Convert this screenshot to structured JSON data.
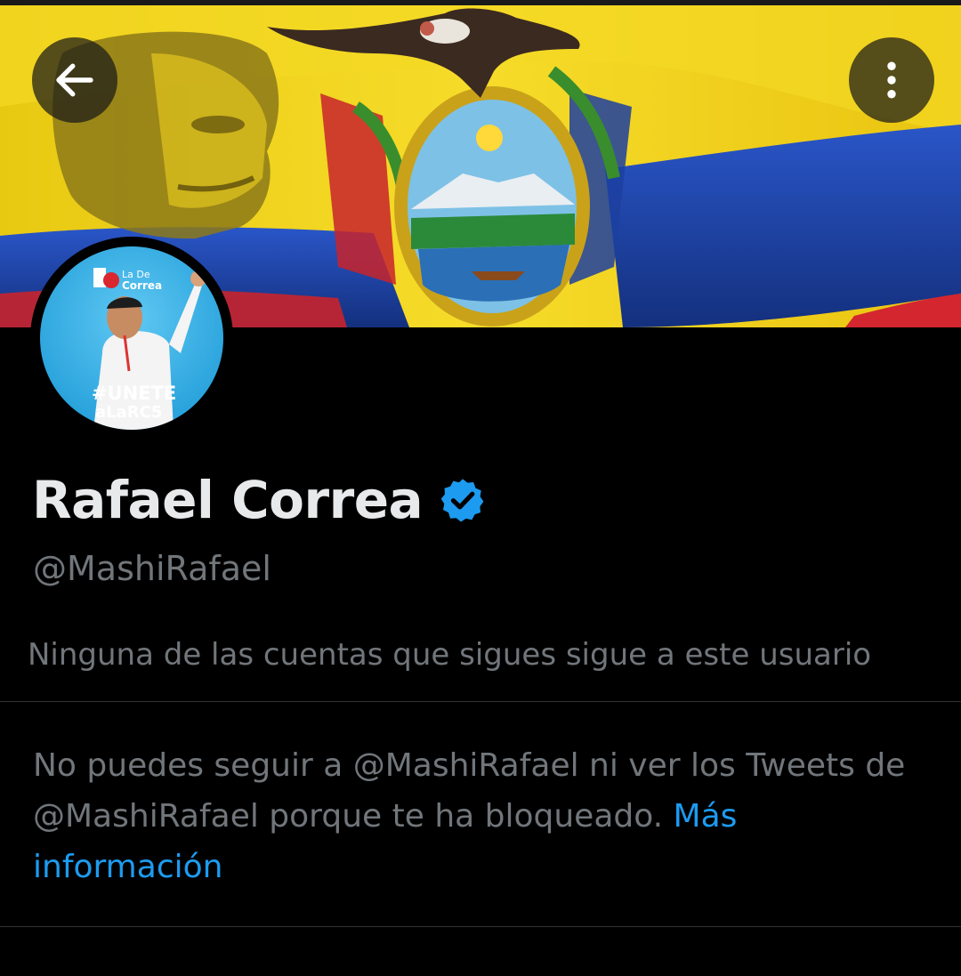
{
  "header": {
    "back_icon": "arrow-left-icon",
    "more_icon": "more-vertical-icon"
  },
  "banner": {
    "description_icon": "ecuador-flag-banner",
    "colors": {
      "yellow": "#f2d21c",
      "blue": "#1c3fa0",
      "red": "#d3262f"
    }
  },
  "avatar": {
    "logo_line1": "La De",
    "logo_line2": "Correa",
    "hashtag_line1": "#UNETE",
    "hashtag_line2": "aLaRC5"
  },
  "profile": {
    "display_name": "Rafael Correa",
    "handle": "@MashiRafael",
    "verified_icon": "verified-badge-icon",
    "verified_color": "#1d9bf0",
    "followers_you_know": "Ninguna de las cuentas que sigues sigue a este usuario"
  },
  "blocked_notice": {
    "text": "No puedes seguir a @MashiRafael ni ver los Tweets de @MashiRafael porque te ha bloqueado.",
    "link_label": "Más información",
    "link_color": "#1d9bf0"
  }
}
